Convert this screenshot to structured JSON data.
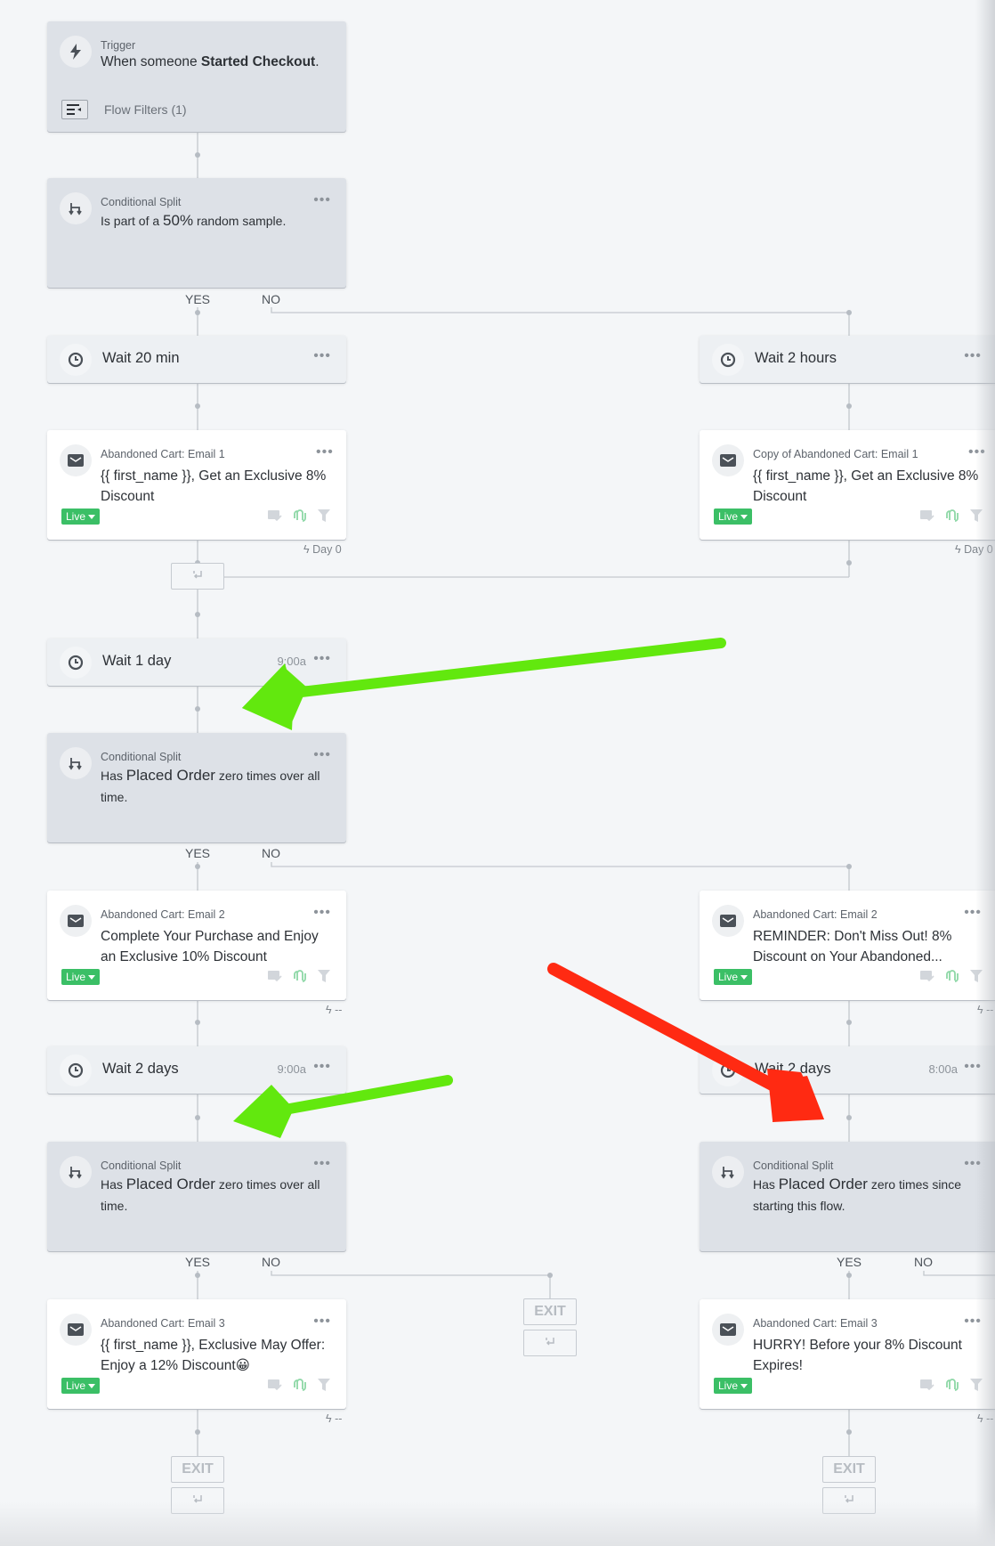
{
  "trigger": {
    "kicker": "Trigger",
    "text_prefix": "When someone ",
    "text_event": "Started Checkout",
    "text_suffix": ".",
    "filters_label": "Flow Filters (1)"
  },
  "split1": {
    "kicker": "Conditional Split",
    "text_prefix": "Is part of a ",
    "text_highlight": "50%",
    "text_suffix": " random sample.",
    "yes": "YES",
    "no": "NO"
  },
  "left": {
    "wait1": {
      "label": "Wait 20 min"
    },
    "email1": {
      "kicker": "Abandoned Cart: Email 1",
      "subject": "{{ first_name }}, Get an Exclusive 8% Discount",
      "status": "Live",
      "day": "Day 0"
    },
    "wait2": {
      "label": "Wait 1 day",
      "time": "9:00a"
    },
    "split2": {
      "kicker": "Conditional Split",
      "prefix": "Has ",
      "metric": "Placed Order",
      "suffix": " zero times over all time.",
      "yes": "YES",
      "no": "NO"
    },
    "email2": {
      "kicker": "Abandoned Cart: Email 2",
      "subject": "Complete Your Purchase and Enjoy an Exclusive 10% Discount",
      "status": "Live",
      "day": "--"
    },
    "wait3": {
      "label": "Wait 2 days",
      "time": "9:00a"
    },
    "split3": {
      "kicker": "Conditional Split",
      "prefix": "Has ",
      "metric": "Placed Order",
      "suffix": " zero times over all time.",
      "yes": "YES",
      "no": "NO"
    },
    "email3": {
      "kicker": "Abandoned Cart: Email 3",
      "subject": "{{ first_name }}, Exclusive May Offer: Enjoy a 12% Discount😀",
      "status": "Live",
      "day": "--"
    },
    "exit_label": "EXIT",
    "no_exit_label": "EXIT"
  },
  "right": {
    "wait1": {
      "label": "Wait 2 hours"
    },
    "email1": {
      "kicker": "Copy of Abandoned Cart: Email 1",
      "subject": "{{ first_name }}, Get an Exclusive 8% Discount",
      "status": "Live",
      "day": "Day 0"
    },
    "email2": {
      "kicker": "Abandoned Cart: Email 2",
      "subject": "REMINDER: Don't Miss Out! 8% Discount on Your Abandoned...",
      "status": "Live",
      "day": "--"
    },
    "wait2": {
      "label": "Wait 2 days",
      "time": "8:00a"
    },
    "split": {
      "kicker": "Conditional Split",
      "prefix": "Has ",
      "metric": "Placed Order",
      "suffix": " zero times since starting this flow.",
      "yes": "YES",
      "no": "NO"
    },
    "email3": {
      "kicker": "Abandoned Cart: Email 3",
      "subject": "HURRY! Before your 8% Discount Expires!",
      "status": "Live",
      "day": "--"
    },
    "exit_label": "EXIT"
  },
  "menu_glyph": "•••",
  "colors": {
    "live_green": "#3bbf66",
    "annotation_green": "#62e80e",
    "annotation_red": "#ff2a12",
    "split_card": "#dde1e7",
    "wait_card": "#edf0f3"
  }
}
